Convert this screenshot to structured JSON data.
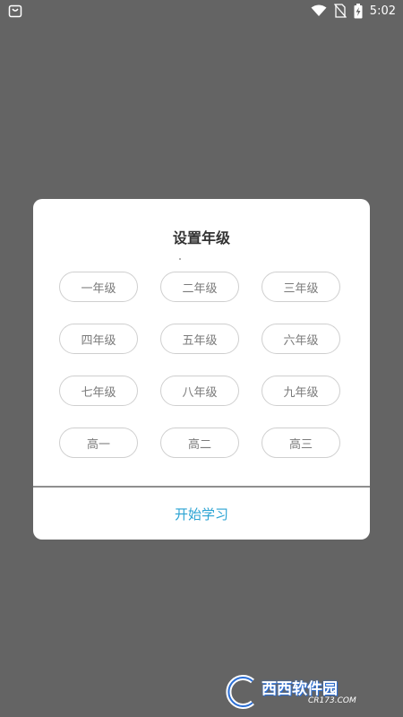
{
  "status_bar": {
    "time": "5:02",
    "icons": [
      "shopping-bag-icon",
      "wifi-icon",
      "no-sim-icon",
      "battery-charging-icon"
    ]
  },
  "dialog": {
    "title": "设置年级",
    "grades": [
      {
        "label": "一年级"
      },
      {
        "label": "二年级"
      },
      {
        "label": "三年级"
      },
      {
        "label": "四年级"
      },
      {
        "label": "五年级"
      },
      {
        "label": "六年级"
      },
      {
        "label": "七年级"
      },
      {
        "label": "八年级"
      },
      {
        "label": "九年级"
      },
      {
        "label": "高一"
      },
      {
        "label": "高二"
      },
      {
        "label": "高三"
      }
    ],
    "start_label": "开始学习",
    "accent_color": "#2aa3d3"
  },
  "watermark": {
    "main": "西西软件园",
    "sub": "CR173.COM"
  }
}
